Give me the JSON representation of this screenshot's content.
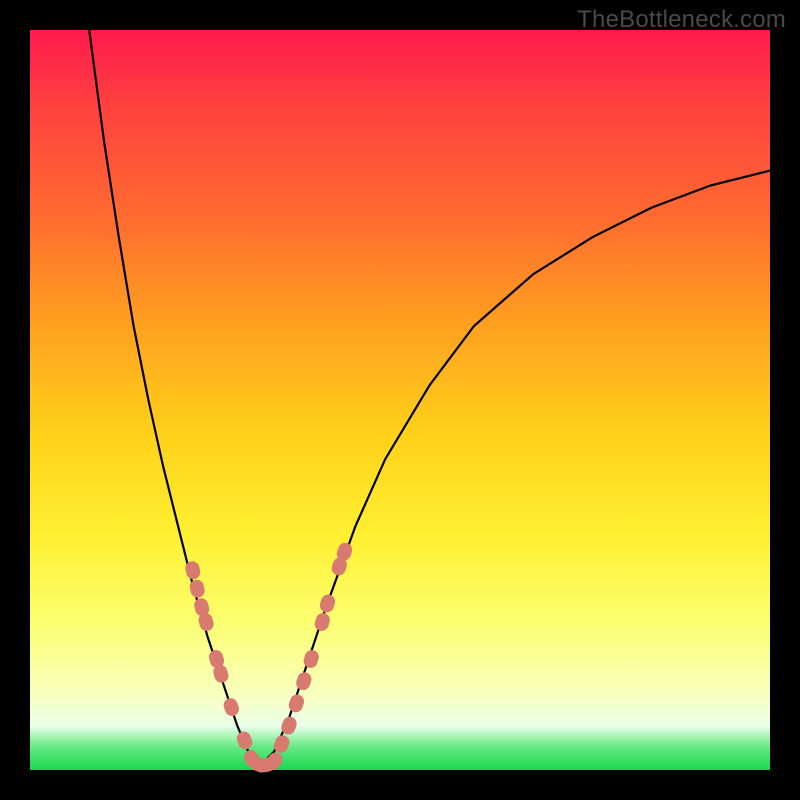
{
  "watermark": "TheBottleneck.com",
  "chart_data": {
    "type": "line",
    "title": "",
    "xlabel": "",
    "ylabel": "",
    "xlim": [
      0,
      100
    ],
    "ylim": [
      0,
      100
    ],
    "series": [
      {
        "name": "left-branch",
        "x": [
          8,
          10,
          12,
          14,
          16,
          18,
          20,
          22,
          24,
          26,
          28,
          29.5,
          31
        ],
        "y": [
          100,
          85,
          72,
          60,
          50,
          41,
          33,
          25,
          18,
          12,
          6,
          2.5,
          0.5
        ]
      },
      {
        "name": "right-branch",
        "x": [
          31,
          33,
          35,
          37,
          40,
          44,
          48,
          54,
          60,
          68,
          76,
          84,
          92,
          100
        ],
        "y": [
          0.5,
          2.5,
          7,
          13,
          22,
          33,
          42,
          52,
          60,
          67,
          72,
          76,
          79,
          81
        ]
      }
    ],
    "beads": {
      "name": "highlight-segments",
      "color": "#d87a70",
      "points": [
        {
          "x": 22.0,
          "y": 27.0
        },
        {
          "x": 22.6,
          "y": 24.5
        },
        {
          "x": 23.2,
          "y": 22.0
        },
        {
          "x": 23.8,
          "y": 20.0
        },
        {
          "x": 25.2,
          "y": 15.0
        },
        {
          "x": 25.8,
          "y": 13.0
        },
        {
          "x": 27.2,
          "y": 8.5
        },
        {
          "x": 29.0,
          "y": 4.0
        },
        {
          "x": 30.0,
          "y": 1.5
        },
        {
          "x": 31.0,
          "y": 0.7
        },
        {
          "x": 32.0,
          "y": 0.7
        },
        {
          "x": 33.0,
          "y": 1.2
        },
        {
          "x": 34.0,
          "y": 3.5
        },
        {
          "x": 35.0,
          "y": 6.0
        },
        {
          "x": 36.0,
          "y": 9.0
        },
        {
          "x": 37.0,
          "y": 12.0
        },
        {
          "x": 38.0,
          "y": 15.0
        },
        {
          "x": 39.5,
          "y": 20.0
        },
        {
          "x": 40.2,
          "y": 22.5
        },
        {
          "x": 41.8,
          "y": 27.5
        },
        {
          "x": 42.5,
          "y": 29.5
        }
      ]
    },
    "gradient_stops": [
      {
        "pos": 0.0,
        "color": "#ff1a4d"
      },
      {
        "pos": 0.25,
        "color": "#ff6a30"
      },
      {
        "pos": 0.55,
        "color": "#ffd21a"
      },
      {
        "pos": 0.8,
        "color": "#fbff70"
      },
      {
        "pos": 0.94,
        "color": "#eaffea"
      },
      {
        "pos": 1.0,
        "color": "#19d851"
      }
    ]
  }
}
